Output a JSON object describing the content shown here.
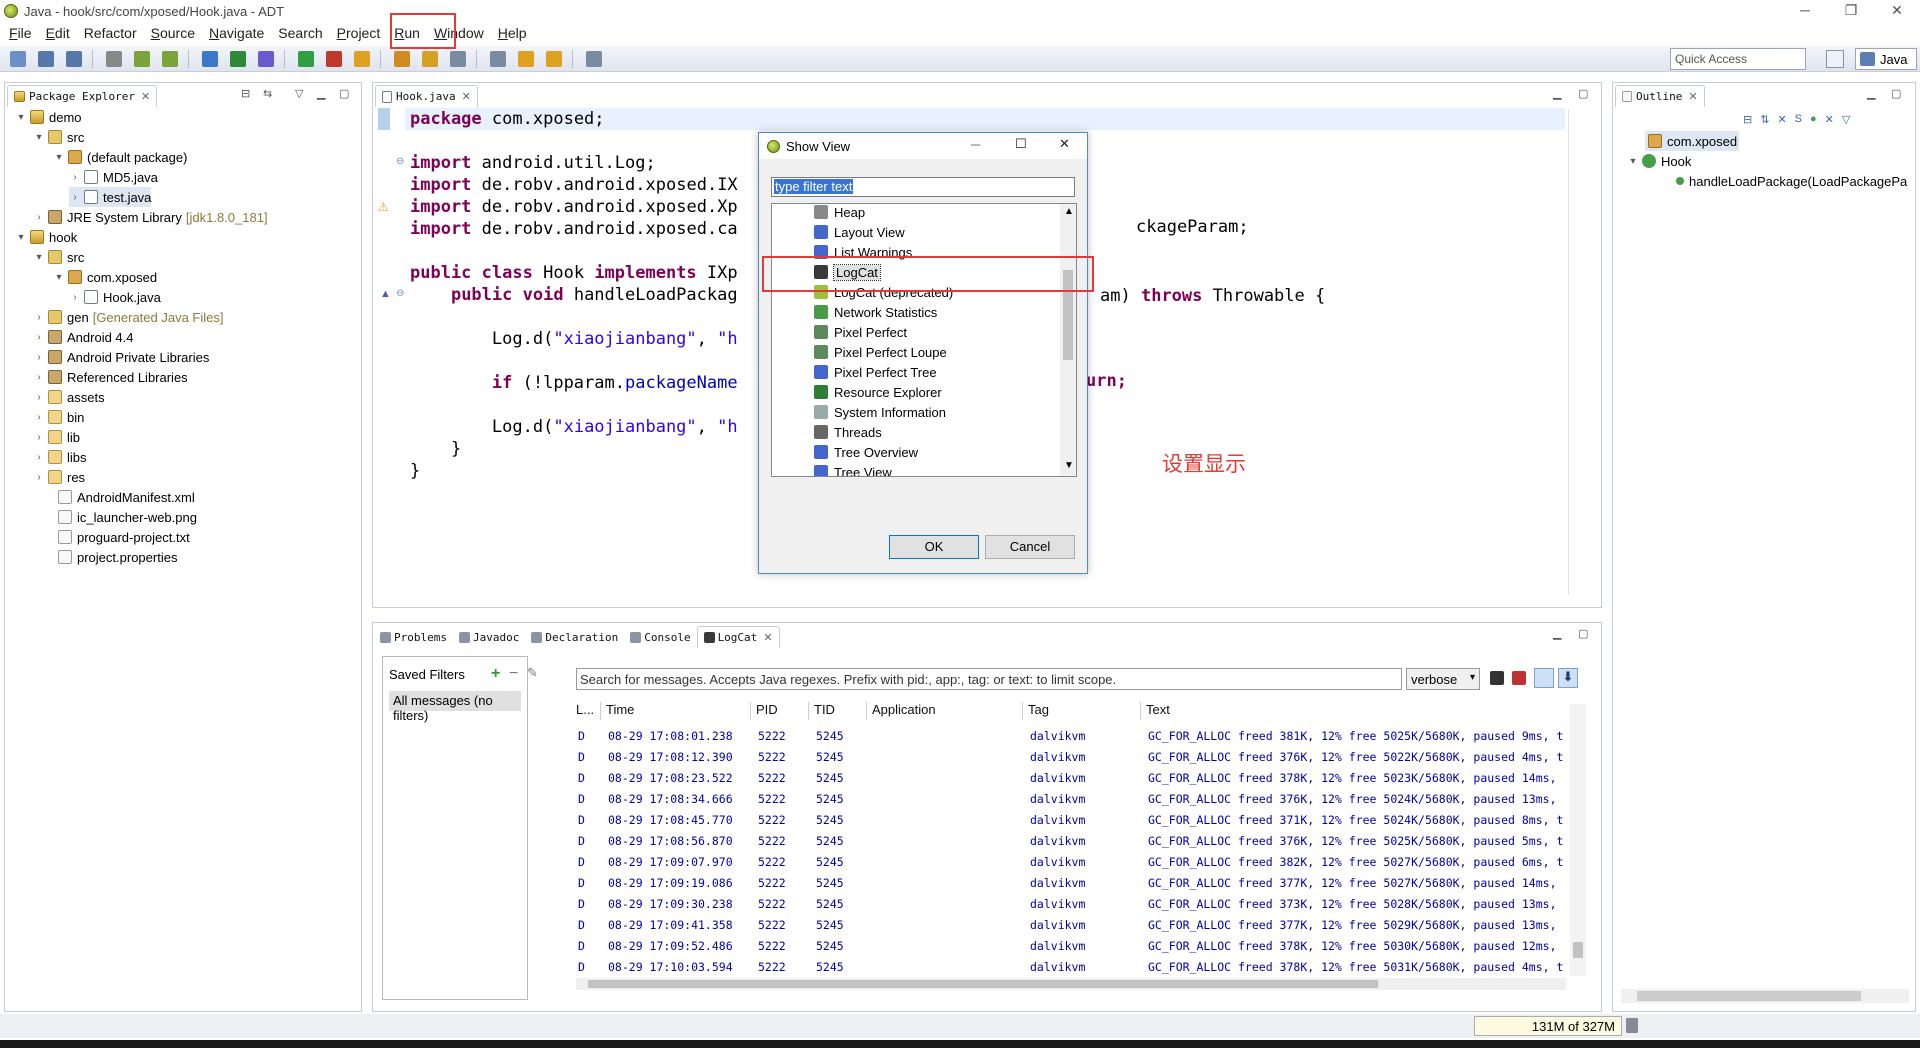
{
  "window": {
    "title": "Java - hook/src/com/xposed/Hook.java - ADT",
    "controls": [
      "─",
      "❐",
      "✕"
    ]
  },
  "menu": [
    {
      "label": "File",
      "u": "F"
    },
    {
      "label": "Edit",
      "u": "E"
    },
    {
      "label": "Refactor",
      "u": ""
    },
    {
      "label": "Source",
      "u": "S"
    },
    {
      "label": "Navigate",
      "u": "N"
    },
    {
      "label": "Search",
      "u": ""
    },
    {
      "label": "Project",
      "u": "P"
    },
    {
      "label": "Run",
      "u": "R"
    },
    {
      "label": "Window",
      "u": "W"
    },
    {
      "label": "Help",
      "u": "H"
    }
  ],
  "toolbar": {
    "quick_access_placeholder": "Quick Access",
    "perspective": "Java"
  },
  "package_explorer": {
    "tab": "Package Explorer",
    "items": [
      {
        "label": "demo",
        "extra": "",
        "icon": "project-icon",
        "arrow": "▾"
      },
      {
        "label": "src",
        "extra": "",
        "icon": "source-folder-icon",
        "arrow": "▾"
      },
      {
        "label": "(default package)",
        "extra": "",
        "icon": "package-icon",
        "arrow": "▾"
      },
      {
        "label": "MD5.java",
        "extra": "",
        "icon": "java-file-icon",
        "arrow": "›"
      },
      {
        "label": "test.java",
        "extra": "",
        "icon": "java-file-icon",
        "arrow": "›"
      },
      {
        "label": "JRE System Library",
        "extra": "[jdk1.8.0_181]",
        "icon": "library-icon",
        "arrow": "›"
      },
      {
        "label": "hook",
        "extra": "",
        "icon": "project-icon",
        "arrow": "▾"
      },
      {
        "label": "src",
        "extra": "",
        "icon": "source-folder-icon",
        "arrow": "▾"
      },
      {
        "label": "com.xposed",
        "extra": "",
        "icon": "package-icon",
        "arrow": "▾"
      },
      {
        "label": "Hook.java",
        "extra": "",
        "icon": "java-file-icon",
        "arrow": "›"
      },
      {
        "label": "gen",
        "extra": "[Generated Java Files]",
        "icon": "source-folder-icon",
        "arrow": "›"
      },
      {
        "label": "Android 4.4",
        "extra": "",
        "icon": "library-icon",
        "arrow": "›"
      },
      {
        "label": "Android Private Libraries",
        "extra": "",
        "icon": "library-icon",
        "arrow": "›"
      },
      {
        "label": "Referenced Libraries",
        "extra": "",
        "icon": "library-icon",
        "arrow": "›"
      },
      {
        "label": "assets",
        "extra": "",
        "icon": "folder-icon",
        "arrow": "›"
      },
      {
        "label": "bin",
        "extra": "",
        "icon": "folder-icon",
        "arrow": "›"
      },
      {
        "label": "lib",
        "extra": "",
        "icon": "folder-icon",
        "arrow": "›"
      },
      {
        "label": "libs",
        "extra": "",
        "icon": "folder-icon",
        "arrow": "›"
      },
      {
        "label": "res",
        "extra": "",
        "icon": "folder-icon",
        "arrow": "›"
      },
      {
        "label": "AndroidManifest.xml",
        "extra": "",
        "icon": "file-icon",
        "arrow": ""
      },
      {
        "label": "ic_launcher-web.png",
        "extra": "",
        "icon": "file-icon",
        "arrow": ""
      },
      {
        "label": "proguard-project.txt",
        "extra": "",
        "icon": "file-icon",
        "arrow": ""
      },
      {
        "label": "project.properties",
        "extra": "",
        "icon": "file-icon",
        "arrow": ""
      }
    ]
  },
  "editor": {
    "tab": "Hook.java",
    "lines": [
      "package com.xposed;",
      "",
      "import android.util.Log;",
      "import de.robv.android.xposed.IX",
      "import de.robv.android.xposed.Xp",
      "import de.robv.android.xposed.ca",
      "",
      "public class Hook implements IXp",
      "    public void handleLoadPackag",
      "",
      "        Log.d(\"xiaojianbang\", \"h",
      "",
      "        if (!lpparam.packageName",
      "",
      "        Log.d(\"xiaojianbang\", \"h",
      "    }",
      "}"
    ],
    "fragments": [
      "ckageParam;",
      "am) throws Throwable {",
      "urn;"
    ],
    "annotation": "设置显示"
  },
  "dialog": {
    "title": "Show View",
    "filter": "type filter text",
    "items": [
      "Heap",
      "Layout View",
      "List Warnings",
      "LogCat",
      "LogCat (deprecated)",
      "Network Statistics",
      "Pixel Perfect",
      "Pixel Perfect Loupe",
      "Pixel Perfect Tree",
      "Resource Explorer",
      "System Information",
      "Threads",
      "Tree Overview",
      "Tree View"
    ],
    "ok": "OK",
    "cancel": "Cancel"
  },
  "outline": {
    "tab": "Outline",
    "items": [
      "com.xposed",
      "Hook",
      "handleLoadPackage(LoadPackagePa"
    ]
  },
  "bottom_tabs": [
    "Problems",
    "Javadoc",
    "Declaration",
    "Console",
    "LogCat"
  ],
  "logcat": {
    "saved_filters": "Saved Filters",
    "all_messages": "All messages (no filters)",
    "search_placeholder": "Search for messages. Accepts Java regexes. Prefix with pid:, app:, tag: or text: to limit scope.",
    "level": "verbose",
    "columns": [
      "L...",
      "Time",
      "PID",
      "TID",
      "Application",
      "Tag",
      "Text"
    ],
    "rows": [
      [
        "D",
        "08-29 17:08:01.238",
        "5222",
        "5245",
        "",
        "dalvikvm",
        "GC_FOR_ALLOC freed 381K, 12% free 5025K/5680K, paused 9ms, t"
      ],
      [
        "D",
        "08-29 17:08:12.390",
        "5222",
        "5245",
        "",
        "dalvikvm",
        "GC_FOR_ALLOC freed 376K, 12% free 5022K/5680K, paused 4ms, t"
      ],
      [
        "D",
        "08-29 17:08:23.522",
        "5222",
        "5245",
        "",
        "dalvikvm",
        "GC_FOR_ALLOC freed 378K, 12% free 5023K/5680K, paused 14ms,"
      ],
      [
        "D",
        "08-29 17:08:34.666",
        "5222",
        "5245",
        "",
        "dalvikvm",
        "GC_FOR_ALLOC freed 376K, 12% free 5024K/5680K, paused 13ms,"
      ],
      [
        "D",
        "08-29 17:08:45.770",
        "5222",
        "5245",
        "",
        "dalvikvm",
        "GC_FOR_ALLOC freed 371K, 12% free 5024K/5680K, paused 8ms, t"
      ],
      [
        "D",
        "08-29 17:08:56.870",
        "5222",
        "5245",
        "",
        "dalvikvm",
        "GC_FOR_ALLOC freed 376K, 12% free 5025K/5680K, paused 5ms, t"
      ],
      [
        "D",
        "08-29 17:09:07.970",
        "5222",
        "5245",
        "",
        "dalvikvm",
        "GC_FOR_ALLOC freed 382K, 12% free 5027K/5680K, paused 6ms, t"
      ],
      [
        "D",
        "08-29 17:09:19.086",
        "5222",
        "5245",
        "",
        "dalvikvm",
        "GC_FOR_ALLOC freed 377K, 12% free 5027K/5680K, paused 14ms,"
      ],
      [
        "D",
        "08-29 17:09:30.238",
        "5222",
        "5245",
        "",
        "dalvikvm",
        "GC_FOR_ALLOC freed 373K, 12% free 5028K/5680K, paused 13ms,"
      ],
      [
        "D",
        "08-29 17:09:41.358",
        "5222",
        "5245",
        "",
        "dalvikvm",
        "GC_FOR_ALLOC freed 377K, 12% free 5029K/5680K, paused 13ms,"
      ],
      [
        "D",
        "08-29 17:09:52.486",
        "5222",
        "5245",
        "",
        "dalvikvm",
        "GC_FOR_ALLOC freed 378K, 12% free 5030K/5680K, paused 12ms,"
      ],
      [
        "D",
        "08-29 17:10:03.594",
        "5222",
        "5245",
        "",
        "dalvikvm",
        "GC_FOR_ALLOC freed 378K, 12% free 5031K/5680K, paused 4ms, t"
      ]
    ]
  },
  "status": {
    "heap": "131M of 327M"
  },
  "colors": {
    "keyword": "#7f0055",
    "string": "#2a00ff",
    "highlight": "#e53935",
    "selection": "#3875d7"
  }
}
